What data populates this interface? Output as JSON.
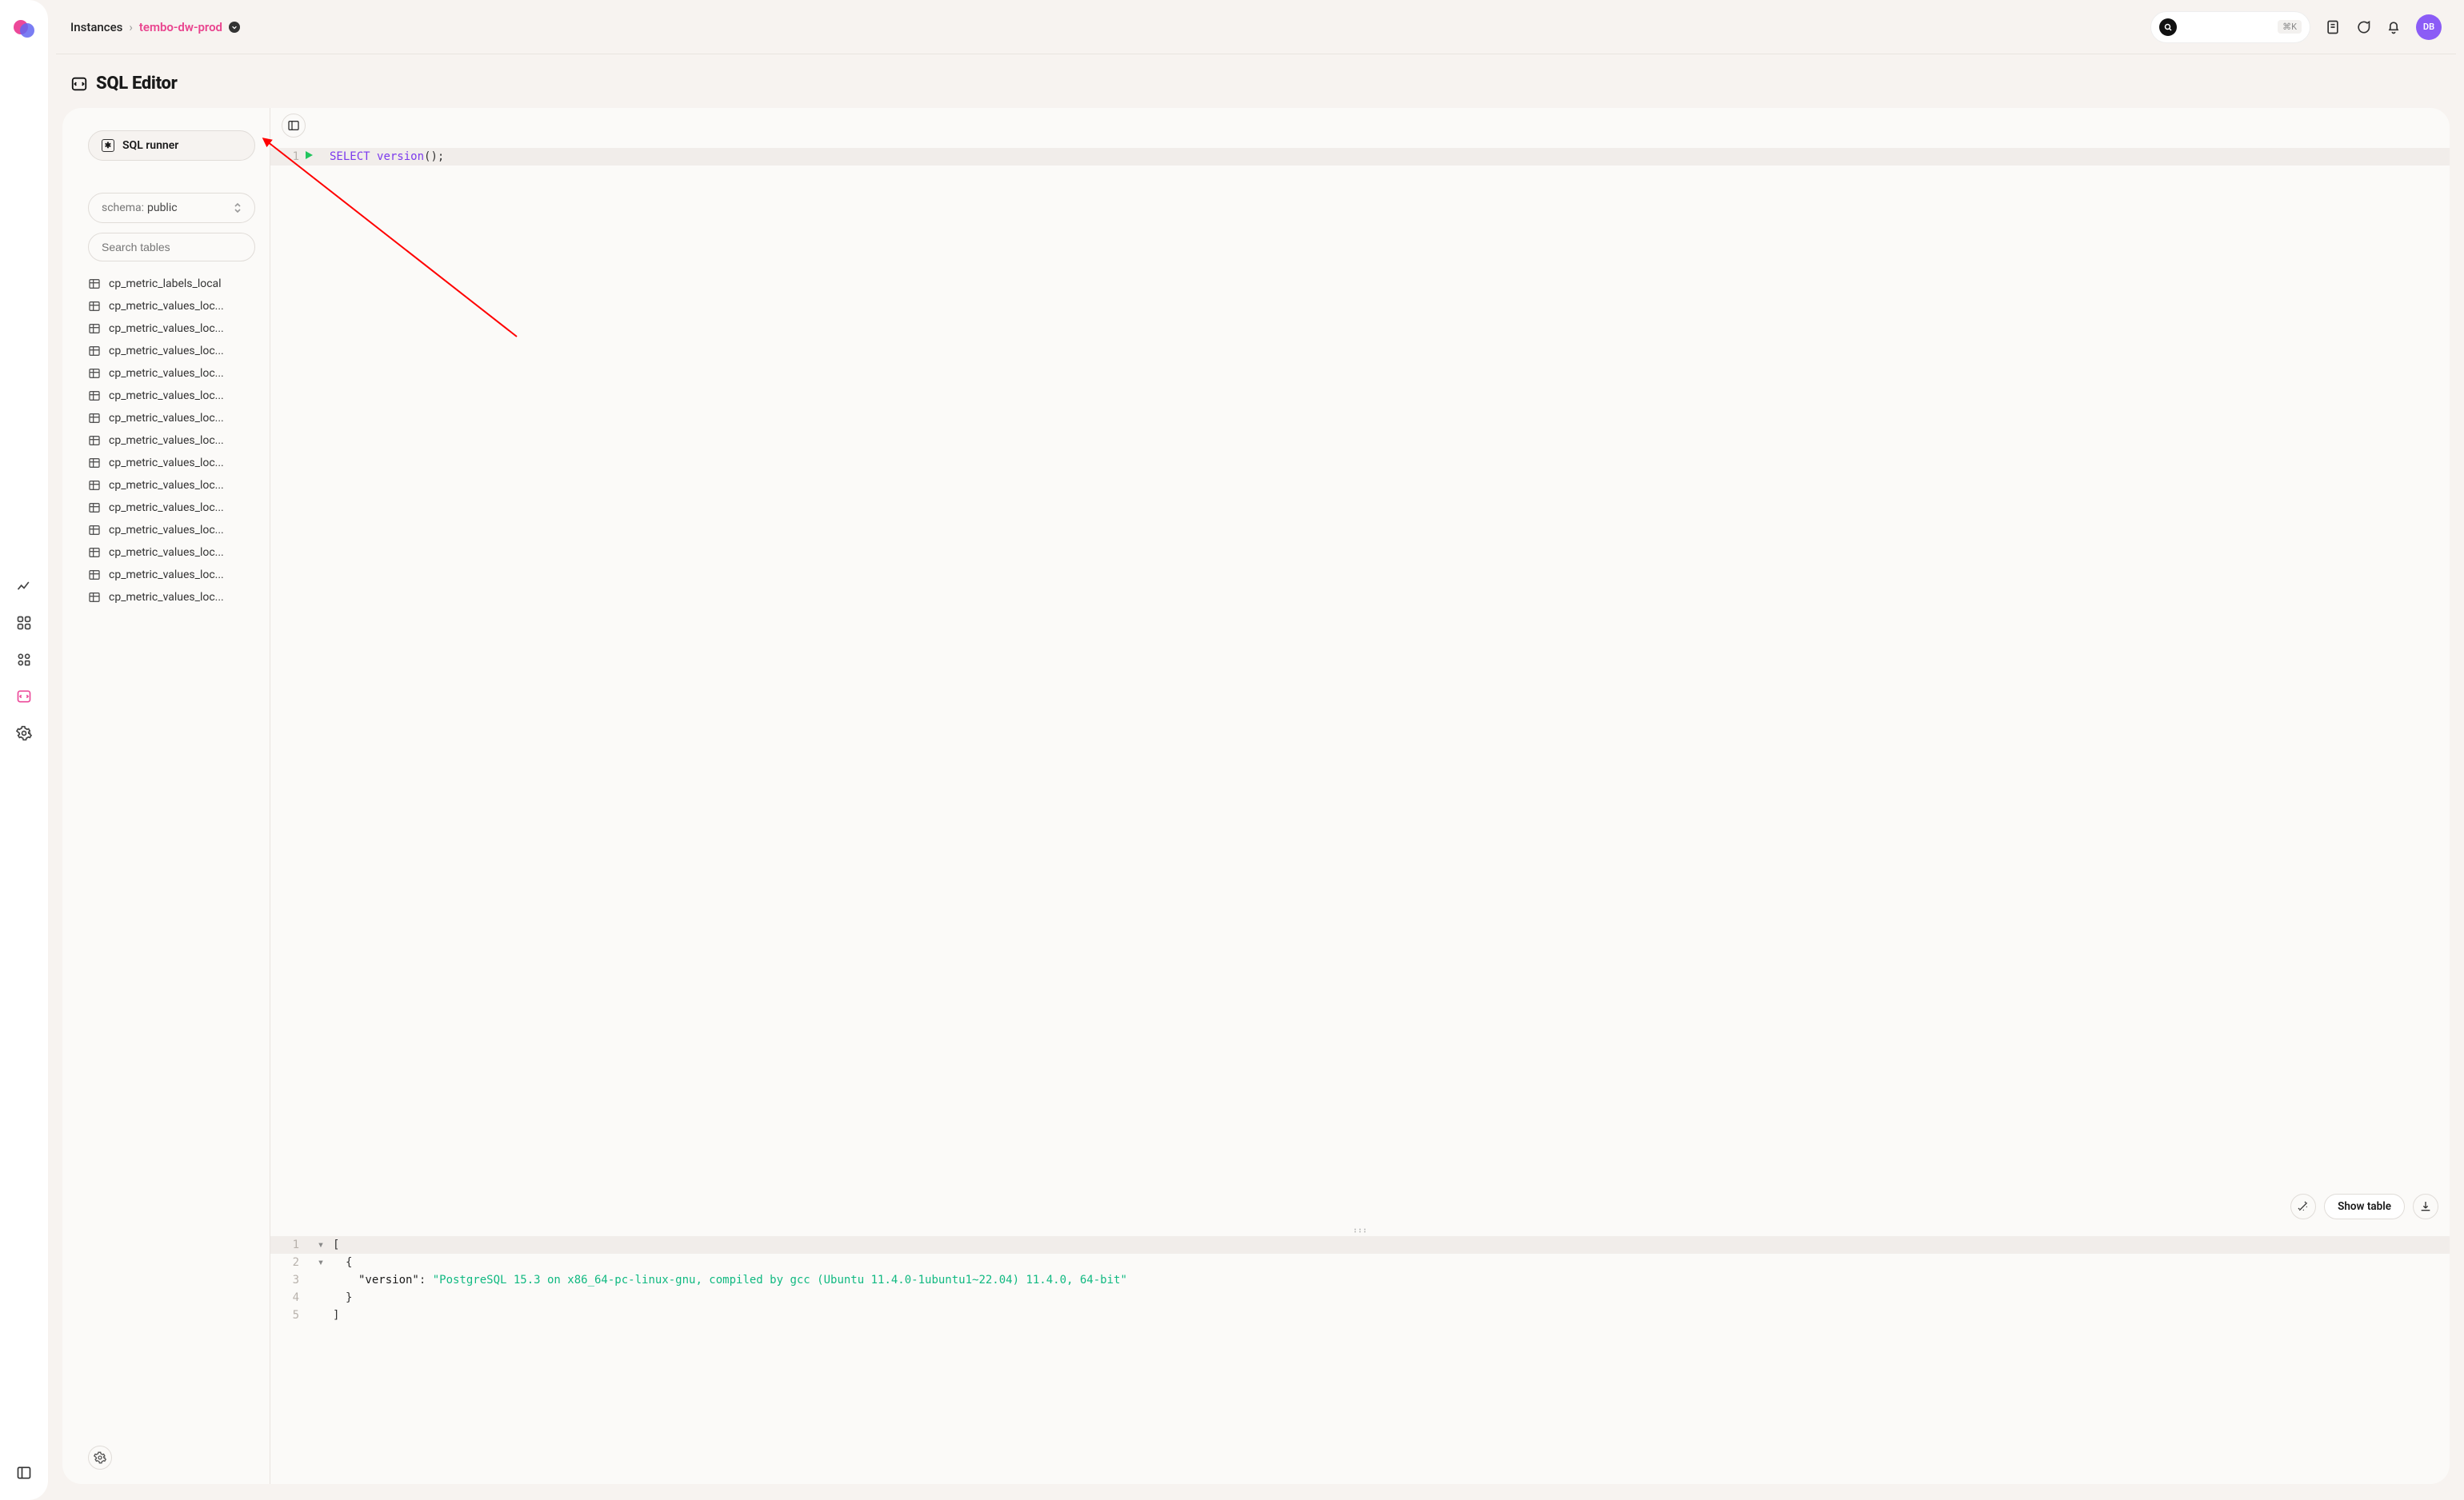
{
  "breadcrumb": {
    "root": "Instances",
    "current": "tembo-dw-prod"
  },
  "topbar": {
    "search_shortcut": "⌘K",
    "avatar_initials": "DB"
  },
  "page": {
    "title": "SQL Editor"
  },
  "sidebar": {
    "sql_runner_label": "SQL runner",
    "schema_label": "schema:",
    "schema_value": "public",
    "search_placeholder": "Search tables",
    "tables": [
      "cp_metric_labels_local",
      "cp_metric_values_loc...",
      "cp_metric_values_loc...",
      "cp_metric_values_loc...",
      "cp_metric_values_loc...",
      "cp_metric_values_loc...",
      "cp_metric_values_loc...",
      "cp_metric_values_loc...",
      "cp_metric_values_loc...",
      "cp_metric_values_loc...",
      "cp_metric_values_loc...",
      "cp_metric_values_loc...",
      "cp_metric_values_loc...",
      "cp_metric_values_loc...",
      "cp_metric_values_loc..."
    ]
  },
  "editor": {
    "query_lines": [
      {
        "n": "1",
        "kw": "SELECT",
        "fn": "version",
        "tail": "();"
      }
    ]
  },
  "results": {
    "show_table_label": "Show table",
    "lines": {
      "l1_n": "1",
      "l1_txt": "[",
      "l2_n": "2",
      "l2_txt": "{",
      "l3_n": "3",
      "l3_key": "\"version\"",
      "l3_colon": ": ",
      "l3_val": "\"PostgreSQL 15.3 on x86_64-pc-linux-gnu, compiled by gcc (Ubuntu 11.4.0-1ubuntu1~22.04) 11.4.0, 64-bit\"",
      "l4_n": "4",
      "l4_txt": "}",
      "l5_n": "5",
      "l5_txt": "]"
    }
  }
}
